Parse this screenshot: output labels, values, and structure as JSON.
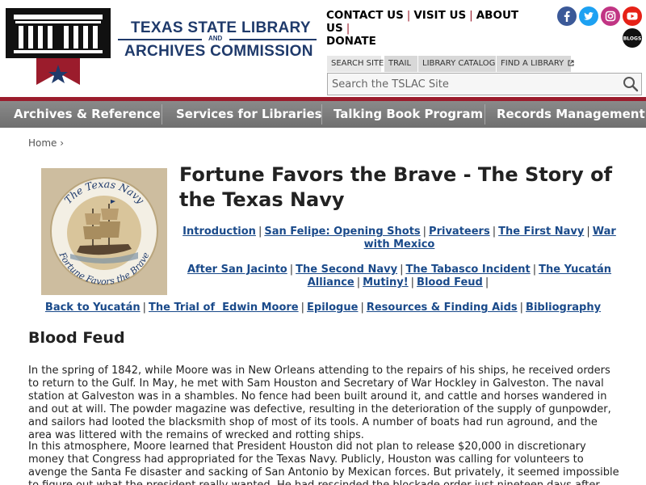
{
  "header": {
    "org_line1": "TEXAS STATE LIBRARY",
    "org_and": "AND",
    "org_line2": "ARCHIVES COMMISSION",
    "utility_links": [
      "CONTACT US",
      "VISIT US",
      "ABOUT US",
      "DONATE"
    ],
    "social": [
      "facebook-icon",
      "twitter-icon",
      "instagram-icon",
      "youtube-icon",
      "blogs-icon"
    ],
    "blogs_label": "BLOGS",
    "brand_colors": {
      "navy": "#1f3a6b",
      "red": "#9b1c2c"
    }
  },
  "search": {
    "tabs": [
      "SEARCH SITE",
      "TRAIL",
      "LIBRARY CATALOG",
      "FIND A LIBRARY"
    ],
    "placeholder": "Search the TSLAC Site"
  },
  "nav": {
    "items": [
      "Archives & Reference",
      "Services for Libraries",
      "Talking Book Program",
      "Records Management"
    ]
  },
  "breadcrumb": {
    "home": "Home",
    "sep": "›"
  },
  "exhibit": {
    "image_text_top": "The Texas Navy",
    "image_text_bottom": "Fortune Favors the Brave",
    "title": "Fortune Favors the Brave - The Story of the Texas Navy",
    "toc_row1": [
      "Introduction",
      "San Felipe: Opening Shots",
      "Privateers",
      "The First Navy",
      "War with Mexico"
    ],
    "toc_row2": [
      "After San Jacinto",
      "The Second Navy",
      "The Tabasco Incident",
      "The Yucatán Alliance",
      "Mutiny!",
      "Blood Feud"
    ],
    "toc_row3": [
      "Back to Yucatán",
      "The Trial of  Edwin Moore",
      "Epilogue",
      "Resources & Finding Aids",
      "Bibliography"
    ],
    "separator": "|"
  },
  "article": {
    "heading": "Blood Feud",
    "p1": "In the spring of 1842, while Moore was in New Orleans attending to the repairs of his ships, he received orders to return to the Gulf. In May, he met with Sam Houston and Secretary of War Hockley in Galveston. The naval station at Galveston was in a shambles. No fence had been built around it, and cattle and horses wandered in and out at will. The powder magazine was defective, resulting in the deterioration of the supply of gunpowder, and sailors had looted the blacksmith shop of most of its tools. A number of boats had run aground, and the area was littered with the remains of wrecked and rotting ships.",
    "p2": "In this atmosphere, Moore learned that President Houston did not plan to release $20,000 in discretionary money that Congress had appropriated for the Texas Navy. Publicly, Houston was calling for volunteers to avenge the Santa Fe disaster and sacking of San Antonio by Mexican forces. But privately, it seemed impossible to figure out what the president really wanted. He had rescinded the blockade order just nineteen days after sending it to Moore; he told Moore he wanted him to"
  }
}
